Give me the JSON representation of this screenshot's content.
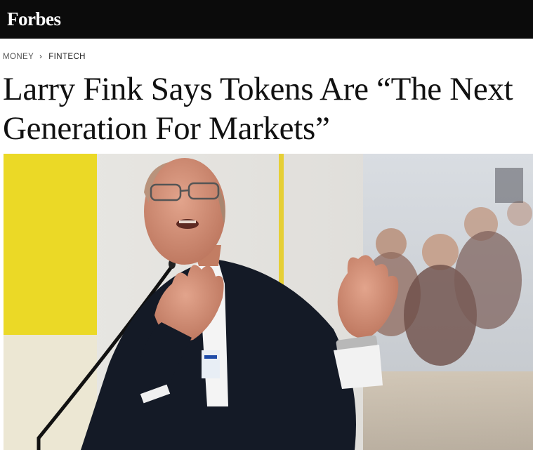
{
  "header": {
    "logo_text": "Forbes"
  },
  "breadcrumb": {
    "section": "MONEY",
    "separator": "›",
    "subsection": "FINTECH"
  },
  "article": {
    "headline_line1": "Larry Fink Says Tokens Are “The Next",
    "headline_line2": "Generation For Markets”"
  },
  "hero_image": {
    "subject": "man-speaking-at-conference-with-microphone"
  },
  "colors": {
    "topbar_bg": "#0b0b0b",
    "logo": "#ffffff",
    "accent_yellow": "#ebd926"
  }
}
